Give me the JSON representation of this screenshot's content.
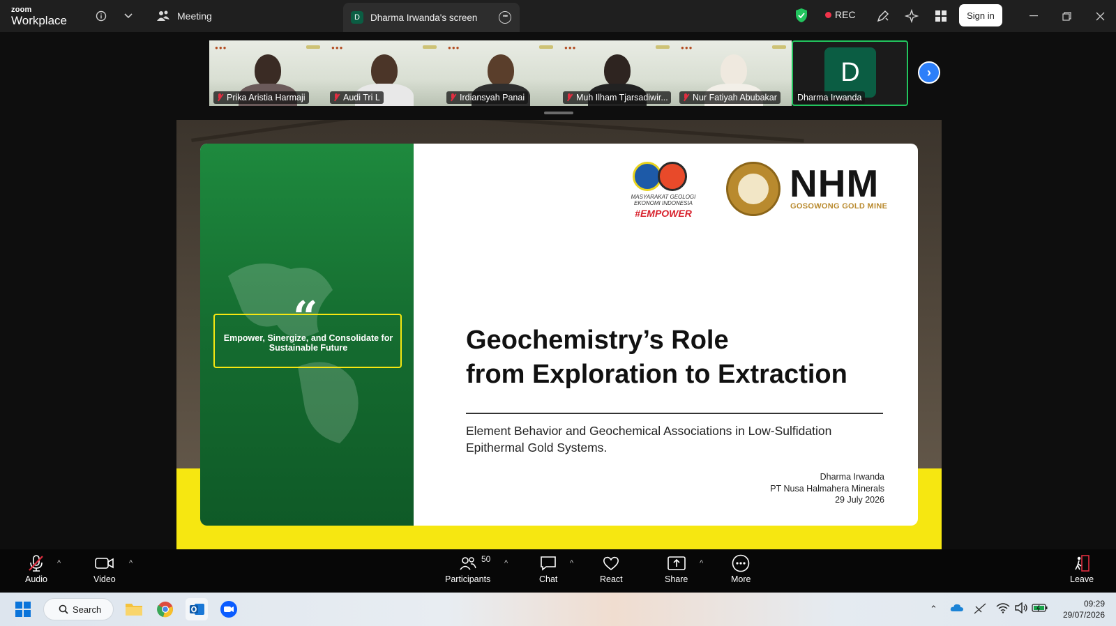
{
  "app": {
    "brand_top": "zoom",
    "brand_bottom": "Workplace"
  },
  "titlebar": {
    "meeting_label": "Meeting",
    "screen_tab_avatar": "D",
    "screen_tab_label": "Dharma Irwanda's screen",
    "rec_label": "REC",
    "signin_label": "Sign in"
  },
  "participants": [
    {
      "name": "Prika Aristia Harmaji",
      "muted": true
    },
    {
      "name": "Audi Tri L",
      "muted": true
    },
    {
      "name": "Irdiansyah Panai",
      "muted": true
    },
    {
      "name": "Muh Ilham Tjarsadiwir...",
      "muted": true
    },
    {
      "name": "Nur Fatiyah Abubakar",
      "muted": true
    },
    {
      "name": "Dharma Irwanda",
      "initial": "D",
      "active": true
    }
  ],
  "slide": {
    "quote": "Empower, Sinergize, and Consolidate for Sustainable Future",
    "mgei_text": "MASYARAKAT GEOLOGI EKONOMI INDONESIA",
    "empower_tag": "#EMPOWER",
    "nhm_logo": "NHM",
    "nhm_sub": "GOSOWONG GOLD MINE",
    "title_line1": "Geochemistry’s Role",
    "title_line2": "from Exploration to Extraction",
    "subtitle": "Element Behavior and Geochemical Associations in Low-Sulfidation Epithermal Gold Systems.",
    "author_name": "Dharma Irwanda",
    "author_org": "PT Nusa Halmahera Minerals",
    "author_date": "29 July 2026"
  },
  "controls": {
    "audio": "Audio",
    "video": "Video",
    "participants": "Participants",
    "participants_count": "50",
    "chat": "Chat",
    "react": "React",
    "share": "Share",
    "more": "More",
    "leave": "Leave"
  },
  "taskbar": {
    "search_label": "Search",
    "time": "09:29",
    "date": "29/07/2026"
  },
  "colors": {
    "accent_green": "#22c55e",
    "slide_green": "#1e8a3e",
    "slide_yellow": "#f6e711",
    "rec_red": "#f0334a",
    "zoom_blue": "#2d7ff9"
  }
}
